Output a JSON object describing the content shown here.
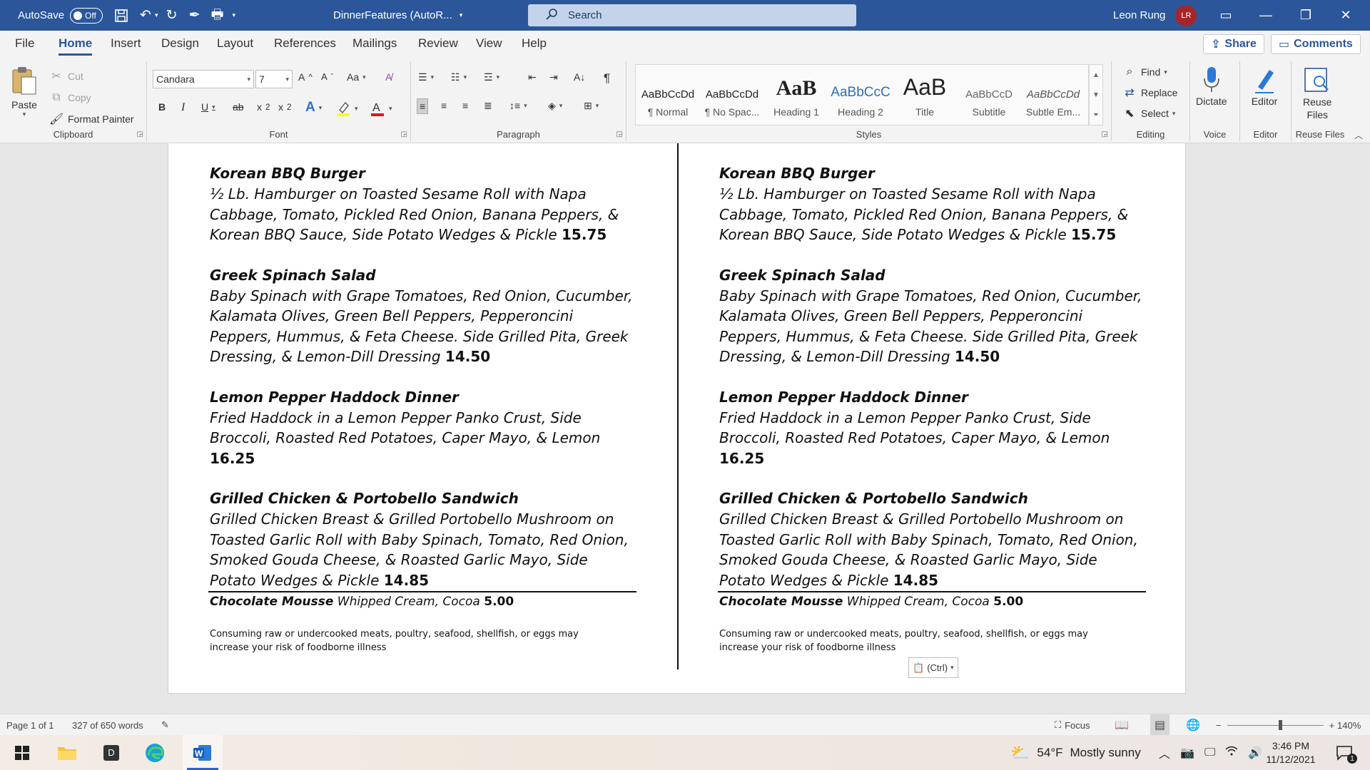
{
  "titlebar": {
    "autosave_label": "AutoSave",
    "autosave_state": "Off",
    "doc_title": "DinnerFeatures (AutoR...",
    "search_placeholder": "Search",
    "user_name": "Leon Rung",
    "user_initials": "LR"
  },
  "tabs": [
    {
      "label": "File"
    },
    {
      "label": "Home"
    },
    {
      "label": "Insert"
    },
    {
      "label": "Design"
    },
    {
      "label": "Layout"
    },
    {
      "label": "References"
    },
    {
      "label": "Mailings"
    },
    {
      "label": "Review"
    },
    {
      "label": "View"
    },
    {
      "label": "Help"
    }
  ],
  "share_label": "Share",
  "comments_label": "Comments",
  "ribbon": {
    "clipboard": {
      "label": "Clipboard",
      "paste": "Paste",
      "cut": "Cut",
      "copy": "Copy",
      "format_painter": "Format Painter"
    },
    "font": {
      "label": "Font",
      "family": "Candara",
      "size": "7"
    },
    "paragraph": {
      "label": "Paragraph"
    },
    "styles": {
      "label": "Styles",
      "items": [
        {
          "sample": "AaBbCcDd",
          "name": "¶ Normal"
        },
        {
          "sample": "AaBbCcDd",
          "name": "¶ No Spac..."
        },
        {
          "sample": "AaB",
          "name": "Heading 1"
        },
        {
          "sample": "AaBbCcC",
          "name": "Heading 2"
        },
        {
          "sample": "AaB",
          "name": "Title"
        },
        {
          "sample": "AaBbCcD",
          "name": "Subtitle"
        },
        {
          "sample": "AaBbCcDd",
          "name": "Subtle Em..."
        }
      ]
    },
    "editing": {
      "label": "Editing",
      "find": "Find",
      "replace": "Replace",
      "select": "Select"
    },
    "voice": {
      "label": "Voice",
      "dictate": "Dictate"
    },
    "editor": {
      "label": "Editor",
      "editor": "Editor"
    },
    "reuse": {
      "label": "Reuse Files",
      "btn_line1": "Reuse",
      "btn_line2": "Files"
    }
  },
  "document": {
    "items": [
      {
        "name": "Korean BBQ Burger",
        "desc": "½ Lb. Hamburger on Toasted Sesame Roll with Napa Cabbage, Tomato, Pickled Red Onion, Banana Peppers, & Korean BBQ Sauce, Side Potato Wedges & Pickle",
        "price": "15.75"
      },
      {
        "name": "Greek Spinach Salad",
        "desc": "Baby Spinach with Grape Tomatoes, Red Onion, Cucumber, Kalamata Olives, Green Bell Peppers, Pepperoncini Peppers, Hummus, & Feta Cheese. Side Grilled Pita, Greek Dressing, & Lemon-Dill Dressing",
        "price": "14.50"
      },
      {
        "name": "Lemon Pepper Haddock Dinner",
        "desc": "Fried Haddock in a Lemon Pepper Panko Crust, Side Broccoli, Roasted Red Potatoes, Caper Mayo, & Lemon",
        "price": "16.25"
      },
      {
        "name": "Grilled Chicken & Portobello Sandwich",
        "desc": "Grilled Chicken Breast & Grilled Portobello Mushroom on Toasted Garlic Roll with Baby Spinach, Tomato, Red Onion, Smoked Gouda Cheese, & Roasted Garlic Mayo, Side Potato Wedges & Pickle",
        "price": "14.85"
      }
    ],
    "dessert": {
      "name": "Chocolate Mousse",
      "desc": "Whipped Cream, Cocoa",
      "price": "5.00"
    },
    "disclaimer_line1": "Consuming raw or undercooked meats, poultry, seafood, shellfish, or eggs may",
    "disclaimer_line2": "increase your risk of foodborne illness",
    "paste_options": "(Ctrl)"
  },
  "statusbar": {
    "page": "Page 1 of 1",
    "words": "327 of 650 words",
    "focus": "Focus",
    "zoom_percent": "140%",
    "zoom_minus": "−",
    "zoom_plus": "+"
  },
  "taskbar": {
    "weather_temp": "54°F",
    "weather_desc": "Mostly sunny",
    "time": "3:46 PM",
    "date": "11/12/2021",
    "notification_count": "1",
    "app_d_label": "D"
  },
  "colors": {
    "word_blue": "#2b579a",
    "avatar_red": "#a4262c"
  }
}
